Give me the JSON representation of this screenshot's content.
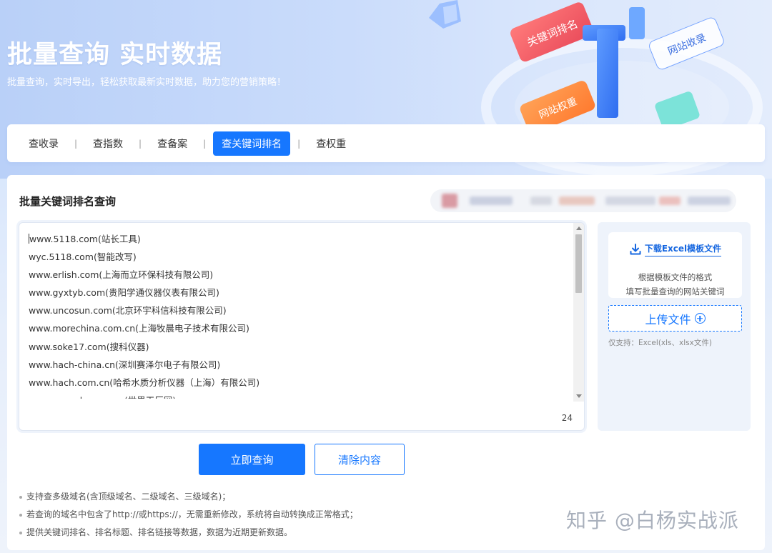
{
  "hero": {
    "title": "批量查询 实时数据",
    "subtitle": "批量查询，实时导出，轻松获取最新实时数据，助力您的营销策略！",
    "deco_labels": [
      "关键词排名",
      "网站收录",
      "网站权重"
    ]
  },
  "tabs": [
    {
      "label": "查收录",
      "active": false
    },
    {
      "label": "查指数",
      "active": false
    },
    {
      "label": "查备案",
      "active": false
    },
    {
      "label": "查关键词排名",
      "active": true
    },
    {
      "label": "查权重",
      "active": false
    }
  ],
  "tab_separator": "|",
  "panel": {
    "title": "批量关键词排名查询"
  },
  "input": {
    "lines": [
      "www.5118.com(站长工具)",
      "wyc.5118.com(智能改写)",
      "www.erlish.com(上海而立环保科技有限公司)",
      "www.gyxtyb.com(贵阳学通仪器仪表有限公司)",
      "www.uncosun.com(北京环宇科信科技有限公司)",
      "www.morechina.com.cn(上海牧晨电子技术有限公司)",
      "www.soke17.com(搜科仪器)",
      "www.hach-china.cn(深圳赛泽尔电子有限公司)",
      "www.hach.com.cn(哈希水质分析仪器（上海）有限公司)",
      "www.gongchang.com(世界工厂网)"
    ],
    "count": "24"
  },
  "upload": {
    "download_label": "下载Excel模板文件",
    "hint_line1": "根据模板文件的格式",
    "hint_line2": "填写批量查询的网站关键词",
    "upload_label": "上传文件",
    "support_note": "仅支持：Excel(xls、xlsx文件)"
  },
  "buttons": {
    "query": "立即查询",
    "clear": "清除内容"
  },
  "notes": [
    "支持查多级域名(含顶级域名、二级域名、三级域名)；",
    "若查询的域名中包含了http://或https://，无需重新修改，系统将自动转换成正常格式；",
    "提供关键词排名、排名标题、排名链接等数据，数据为近期更新数据。"
  ],
  "watermark": "知乎 @白杨实战派",
  "colors": {
    "accent": "#1677ff",
    "deco_red": "#f25a5a",
    "deco_orange": "#ff8a3d",
    "deco_blue": "#3b7cf6"
  }
}
